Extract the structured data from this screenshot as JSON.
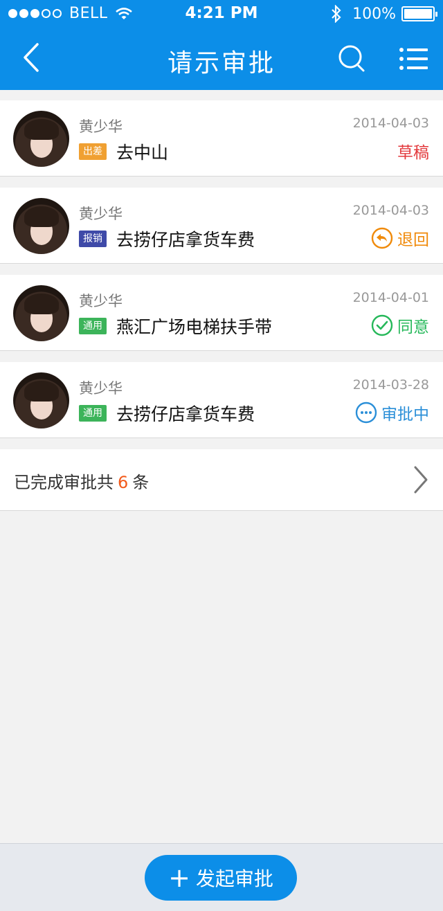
{
  "status_bar": {
    "carrier": "BELL",
    "time": "4:21 PM",
    "battery": "100%"
  },
  "nav": {
    "title": "请示审批",
    "icons": [
      "back-icon",
      "search-icon",
      "menu-icon"
    ]
  },
  "items": [
    {
      "name": "黄少华",
      "date": "2014-04-03",
      "tag": "出差",
      "tag_color": "#f0a032",
      "subject": "去中山",
      "status": "草稿",
      "status_color": "#e3393c",
      "status_icon": ""
    },
    {
      "name": "黄少华",
      "date": "2014-04-03",
      "tag": "报销",
      "tag_color": "#3f4aa8",
      "subject": "去捞仔店拿货车费",
      "status": "退回",
      "status_color": "#f08a0a",
      "status_icon": "return-icon"
    },
    {
      "name": "黄少华",
      "date": "2014-04-01",
      "tag": "通用",
      "tag_color": "#3cb45a",
      "subject": "燕汇广场电梯扶手带",
      "status": "同意",
      "status_color": "#26b85a",
      "status_icon": "check-circle-icon"
    },
    {
      "name": "黄少华",
      "date": "2014-03-28",
      "tag": "通用",
      "tag_color": "#3cb45a",
      "subject": "去捞仔店拿货车费",
      "status": "审批中",
      "status_color": "#2b8fd8",
      "status_icon": "more-circle-icon"
    }
  ],
  "completed": {
    "prefix": "已完成审批共",
    "count": "6",
    "suffix": "条"
  },
  "bottom": {
    "new_button_label": "发起审批",
    "plus": "+"
  },
  "colors": {
    "primary": "#0c8ee8",
    "background": "#f2f2f2"
  }
}
